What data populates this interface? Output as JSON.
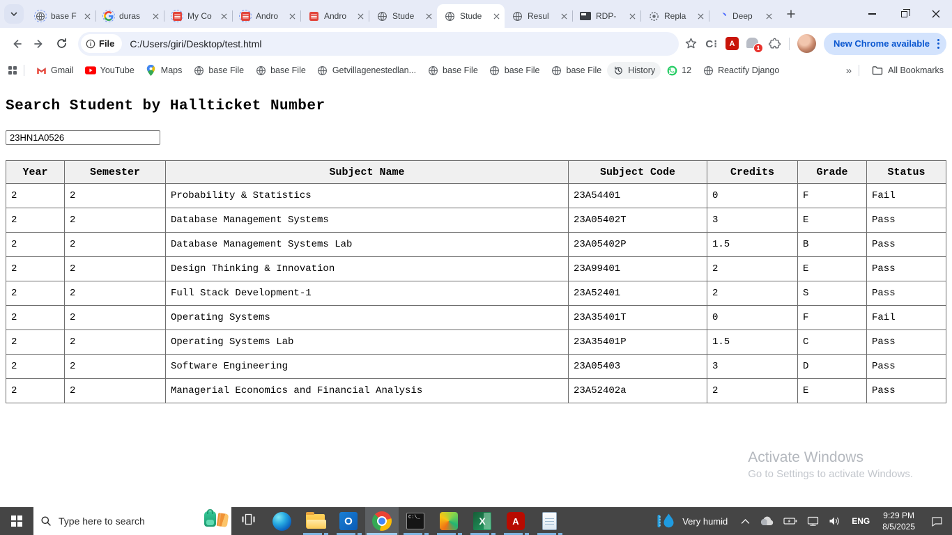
{
  "browser": {
    "tabs": [
      {
        "title": "base F",
        "icon": "globe",
        "loading": true,
        "active": false
      },
      {
        "title": "duras",
        "icon": "google",
        "loading": true,
        "active": false
      },
      {
        "title": "My Co",
        "icon": "redtile",
        "loading": true,
        "active": false
      },
      {
        "title": "Andro",
        "icon": "redtile",
        "loading": true,
        "active": false
      },
      {
        "title": "Andro",
        "icon": "redtile",
        "loading": false,
        "active": false
      },
      {
        "title": "Stude",
        "icon": "globe",
        "loading": false,
        "active": false
      },
      {
        "title": "Stude",
        "icon": "globe",
        "loading": false,
        "active": true
      },
      {
        "title": "Resul",
        "icon": "globe",
        "loading": false,
        "active": false
      },
      {
        "title": "RDP-",
        "icon": "rdp",
        "loading": false,
        "active": false
      },
      {
        "title": "Repla",
        "icon": "gear",
        "loading": false,
        "active": false
      },
      {
        "title": "Deep",
        "icon": "deepseek",
        "loading": false,
        "active": false
      }
    ],
    "toolbar": {
      "file_chip": "File",
      "url": "C:/Users/giri/Desktop/test.html",
      "c_extension_label": "C",
      "extension_badge_count": "1",
      "update_button": "New Chrome available"
    },
    "bookmarks_bar": {
      "items": [
        {
          "label": "Gmail",
          "icon": "gmail"
        },
        {
          "label": "YouTube",
          "icon": "youtube"
        },
        {
          "label": "Maps",
          "icon": "maps"
        },
        {
          "label": "base File",
          "icon": "globe"
        },
        {
          "label": "base File",
          "icon": "globe"
        },
        {
          "label": "Getvillagenestedlan...",
          "icon": "globe"
        },
        {
          "label": "base File",
          "icon": "globe"
        },
        {
          "label": "base File",
          "icon": "globe"
        },
        {
          "label": "base File",
          "icon": "globe"
        },
        {
          "label": "History",
          "icon": "history",
          "pill": true
        },
        {
          "label": "12",
          "icon": "whatsapp"
        },
        {
          "label": "Reactify Django",
          "icon": "globe"
        }
      ],
      "overflow_chevron": "»",
      "all_bookmarks_label": "All Bookmarks"
    }
  },
  "page": {
    "title": "Search Student by Hallticket Number",
    "search_value": "23HN1A0526",
    "table": {
      "headers": [
        "Year",
        "Semester",
        "Subject Name",
        "Subject Code",
        "Credits",
        "Grade",
        "Status"
      ],
      "rows": [
        [
          "2",
          "2",
          "Probability & Statistics",
          "23A54401",
          "0",
          "F",
          "Fail"
        ],
        [
          "2",
          "2",
          "Database Management Systems",
          "23A05402T",
          "3",
          "E",
          "Pass"
        ],
        [
          "2",
          "2",
          "Database Management Systems Lab",
          "23A05402P",
          "1.5",
          "B",
          "Pass"
        ],
        [
          "2",
          "2",
          "Design Thinking & Innovation",
          "23A99401",
          "2",
          "E",
          "Pass"
        ],
        [
          "2",
          "2",
          "Full Stack Development-1",
          "23A52401",
          "2",
          "S",
          "Pass"
        ],
        [
          "2",
          "2",
          "Operating Systems",
          "23A35401T",
          "0",
          "F",
          "Fail"
        ],
        [
          "2",
          "2",
          "Operating Systems Lab",
          "23A35401P",
          "1.5",
          "C",
          "Pass"
        ],
        [
          "2",
          "2",
          "Software Engineering",
          "23A05403",
          "3",
          "D",
          "Pass"
        ],
        [
          "2",
          "2",
          "Managerial Economics and Financial Analysis",
          "23A52402a",
          "2",
          "E",
          "Pass"
        ]
      ]
    },
    "watermark": {
      "line1": "Activate Windows",
      "line2": "Go to Settings to activate Windows."
    }
  },
  "taskbar": {
    "search_placeholder": "Type here to search",
    "apps": [
      {
        "name": "task-view",
        "icon": "taskview",
        "running": false,
        "active": false
      },
      {
        "name": "edge",
        "icon": "edge",
        "running": false,
        "active": false
      },
      {
        "name": "file-explorer",
        "icon": "file-explorer",
        "running": true,
        "active": false
      },
      {
        "name": "outlook",
        "icon": "outlook",
        "running": true,
        "active": false
      },
      {
        "name": "chrome",
        "icon": "chrome",
        "running": true,
        "active": true
      },
      {
        "name": "terminal",
        "icon": "terminal",
        "running": true,
        "active": false
      },
      {
        "name": "pycharm",
        "icon": "pycharm",
        "running": true,
        "active": false
      },
      {
        "name": "excel",
        "icon": "excel",
        "running": true,
        "active": false
      },
      {
        "name": "acrobat",
        "icon": "acrobat",
        "running": true,
        "active": false
      },
      {
        "name": "notepad",
        "icon": "notepad",
        "running": true,
        "active": false
      }
    ],
    "weather_label": "Very humid",
    "tray_icons": [
      "chevron-up",
      "onedrive",
      "battery",
      "network",
      "volume"
    ],
    "language": "ENG",
    "time": "9:29 PM",
    "date": "8/5/2025"
  },
  "colors": {
    "accent_blue": "#0b57d0",
    "update_pill_bg": "#d3e3fd",
    "tabstrip_bg": "#e7ebf7",
    "taskbar_bg": "#454545",
    "run_indicator": "#7db4e0",
    "table_header_bg": "#f0f0f0"
  }
}
